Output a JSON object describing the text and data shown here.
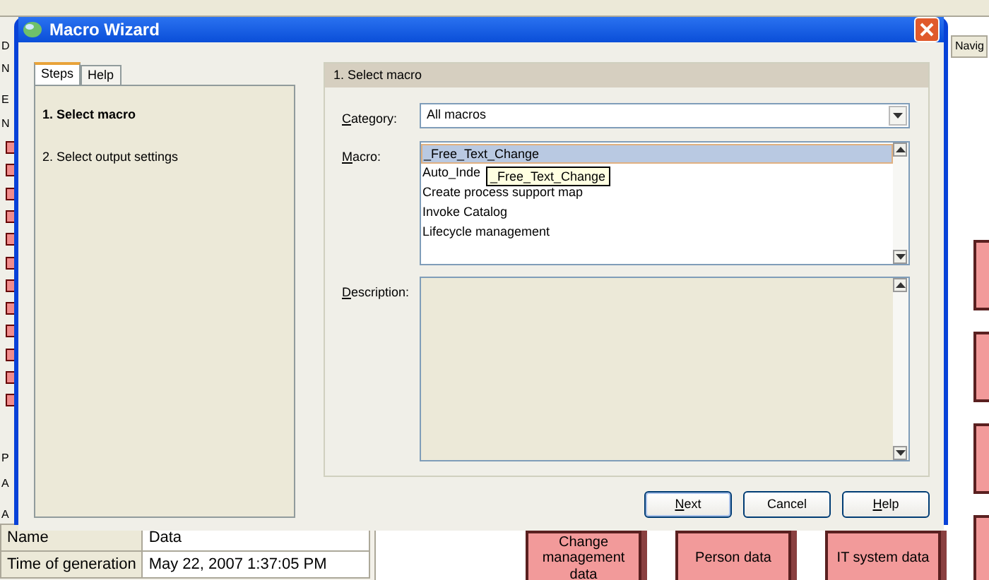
{
  "background_app": {
    "side_labels": [
      "D",
      "N",
      "E",
      "N",
      "P",
      "A",
      "A"
    ],
    "properties": [
      {
        "name": "Name",
        "value": "Data"
      },
      {
        "name": "Time of generation",
        "value": "May 22, 2007 1:37:05 PM"
      }
    ],
    "navigator_tab": "Navig",
    "diagram_objects": [
      {
        "label": "Change management data"
      },
      {
        "label": "Person data"
      },
      {
        "label": "IT system data"
      }
    ]
  },
  "dialog": {
    "title": "Macro Wizard",
    "tabs": [
      {
        "label": "Steps",
        "selected": true
      },
      {
        "label": "Help",
        "selected": false
      }
    ],
    "steps": [
      {
        "label": "1. Select macro",
        "selected": true
      },
      {
        "label": "2. Select output settings",
        "selected": false
      }
    ],
    "section_title": "1. Select macro",
    "category": {
      "label": "Category:",
      "mnemonic": true,
      "value": "All macros"
    },
    "macro": {
      "label": "Macro:",
      "mnemonic": true,
      "items": [
        {
          "label": "_Free_Text_Change",
          "selected": true
        },
        {
          "label": "Auto_Inde",
          "selected": false
        },
        {
          "label": "Create process support map",
          "selected": false
        },
        {
          "label": "Invoke Catalog",
          "selected": false
        },
        {
          "label": "Lifecycle management",
          "selected": false
        }
      ],
      "tooltip": "_Free_Text_Change"
    },
    "description": {
      "label": "Description:",
      "mnemonic": true
    },
    "buttons": [
      {
        "label": "Next",
        "mnemonic": true,
        "default": true
      },
      {
        "label": "Cancel",
        "mnemonic": false,
        "default": false
      },
      {
        "label": "Help",
        "mnemonic": true,
        "default": false
      }
    ]
  }
}
